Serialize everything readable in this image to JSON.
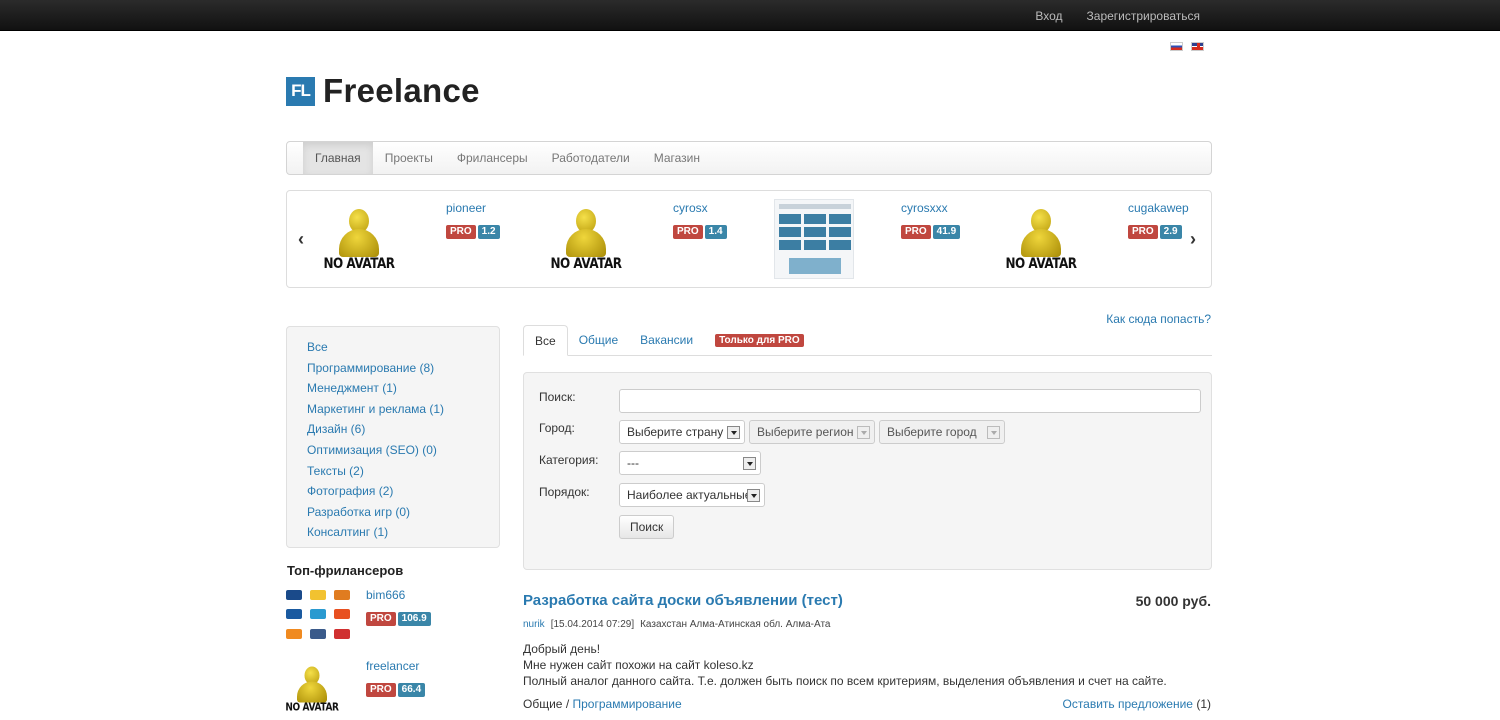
{
  "topbar": {
    "login": "Вход",
    "register": "Зарегистрироваться"
  },
  "languages": [
    "ru",
    "en"
  ],
  "logo": {
    "badge": "FL",
    "text": "Freelance"
  },
  "nav": [
    "Главная",
    "Проекты",
    "Фрилансеры",
    "Работодатели",
    "Магазин"
  ],
  "carousel": {
    "prev": "‹",
    "next": "›",
    "items": [
      {
        "name": "pioneer",
        "pro": "PRO",
        "rating": "1.2",
        "avatar": "NO AVATAR"
      },
      {
        "name": "cyrosx",
        "pro": "PRO",
        "rating": "1.4",
        "avatar": "NO AVATAR"
      },
      {
        "name": "cyrosxxx",
        "pro": "PRO",
        "rating": "41.9",
        "avatar": "screenshot"
      },
      {
        "name": "cugakawep",
        "pro": "PRO",
        "rating": "2.9",
        "avatar": "NO AVATAR"
      }
    ]
  },
  "categories": [
    "Все",
    "Программирование (8)",
    "Менеджмент (1)",
    "Маркетинг и реклама (1)",
    "Дизайн (6)",
    "Оптимизация (SEO) (0)",
    "Тексты (2)",
    "Фотография (2)",
    "Разработка игр (0)",
    "Консалтинг (1)"
  ],
  "top_freelancers": {
    "title": "Топ-фрилансеров",
    "items": [
      {
        "name": "bim666",
        "pro": "PRO",
        "rating": "106.9",
        "avatar": "payment-logos"
      },
      {
        "name": "freelancer",
        "pro": "PRO",
        "rating": "66.4",
        "avatar": "NO AVATAR"
      }
    ]
  },
  "how_link": "Как сюда попасть?",
  "tabs": {
    "all": "Все",
    "general": "Общие",
    "vacancies": "Вакансии",
    "pro_only": "Только для PRO"
  },
  "filter": {
    "search_label": "Поиск:",
    "search_value": "",
    "city_label": "Город:",
    "country": "Выберите страну",
    "region": "Выберите регион",
    "city": "Выберите город",
    "category_label": "Категория:",
    "category": "---",
    "order_label": "Порядок:",
    "order": "Наиболее актуальные",
    "button": "Поиск"
  },
  "project": {
    "title": "Разработка сайта доски объявлении (тест)",
    "price": "50 000 руб.",
    "author": "nurik",
    "date": "[15.04.2014 07:29]",
    "location": "Казахстан Алма-Атинская обл. Алма-Ата",
    "lines": [
      "Добрый день!",
      "Мне нужен сайт похожи на сайт koleso.kz",
      "Полный аналог данного сайта. Т.е. должен быть поиск по всем критериям, выделения объявления и счет на сайте."
    ],
    "category": "Общие",
    "separator": "/",
    "subcategory": "Программирование",
    "offer": "Оставить предложение",
    "offer_count": "(1)"
  },
  "colors": {
    "link": "#2a7ab0",
    "pro": "#c0473f",
    "rating": "#3a86a8",
    "logo": "#2a7ab0"
  }
}
